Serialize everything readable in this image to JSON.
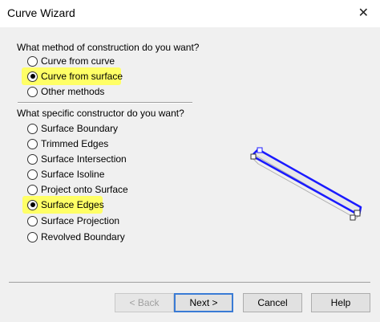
{
  "window": {
    "title": "Curve Wizard",
    "close_icon": "close-icon"
  },
  "method": {
    "question": "What method of construction do you want?",
    "options": [
      {
        "label": "Curve from curve",
        "checked": false
      },
      {
        "label": "Curve from surface",
        "checked": true
      },
      {
        "label": "Other methods",
        "checked": false
      }
    ]
  },
  "constructor": {
    "question": "What specific constructor do you want?",
    "options": [
      {
        "label": "Surface Boundary",
        "checked": false
      },
      {
        "label": "Trimmed Edges",
        "checked": false
      },
      {
        "label": "Surface Intersection",
        "checked": false
      },
      {
        "label": "Surface Isoline",
        "checked": false
      },
      {
        "label": "Project onto Surface",
        "checked": false
      },
      {
        "label": "Surface Edges",
        "checked": true
      },
      {
        "label": "Surface Projection",
        "checked": false
      },
      {
        "label": "Revolved Boundary",
        "checked": false
      }
    ]
  },
  "buttons": {
    "back": "< Back",
    "next": "Next >",
    "cancel": "Cancel",
    "help": "Help"
  },
  "colors": {
    "highlight": "#ffff66",
    "curve": "#1a1aff"
  }
}
